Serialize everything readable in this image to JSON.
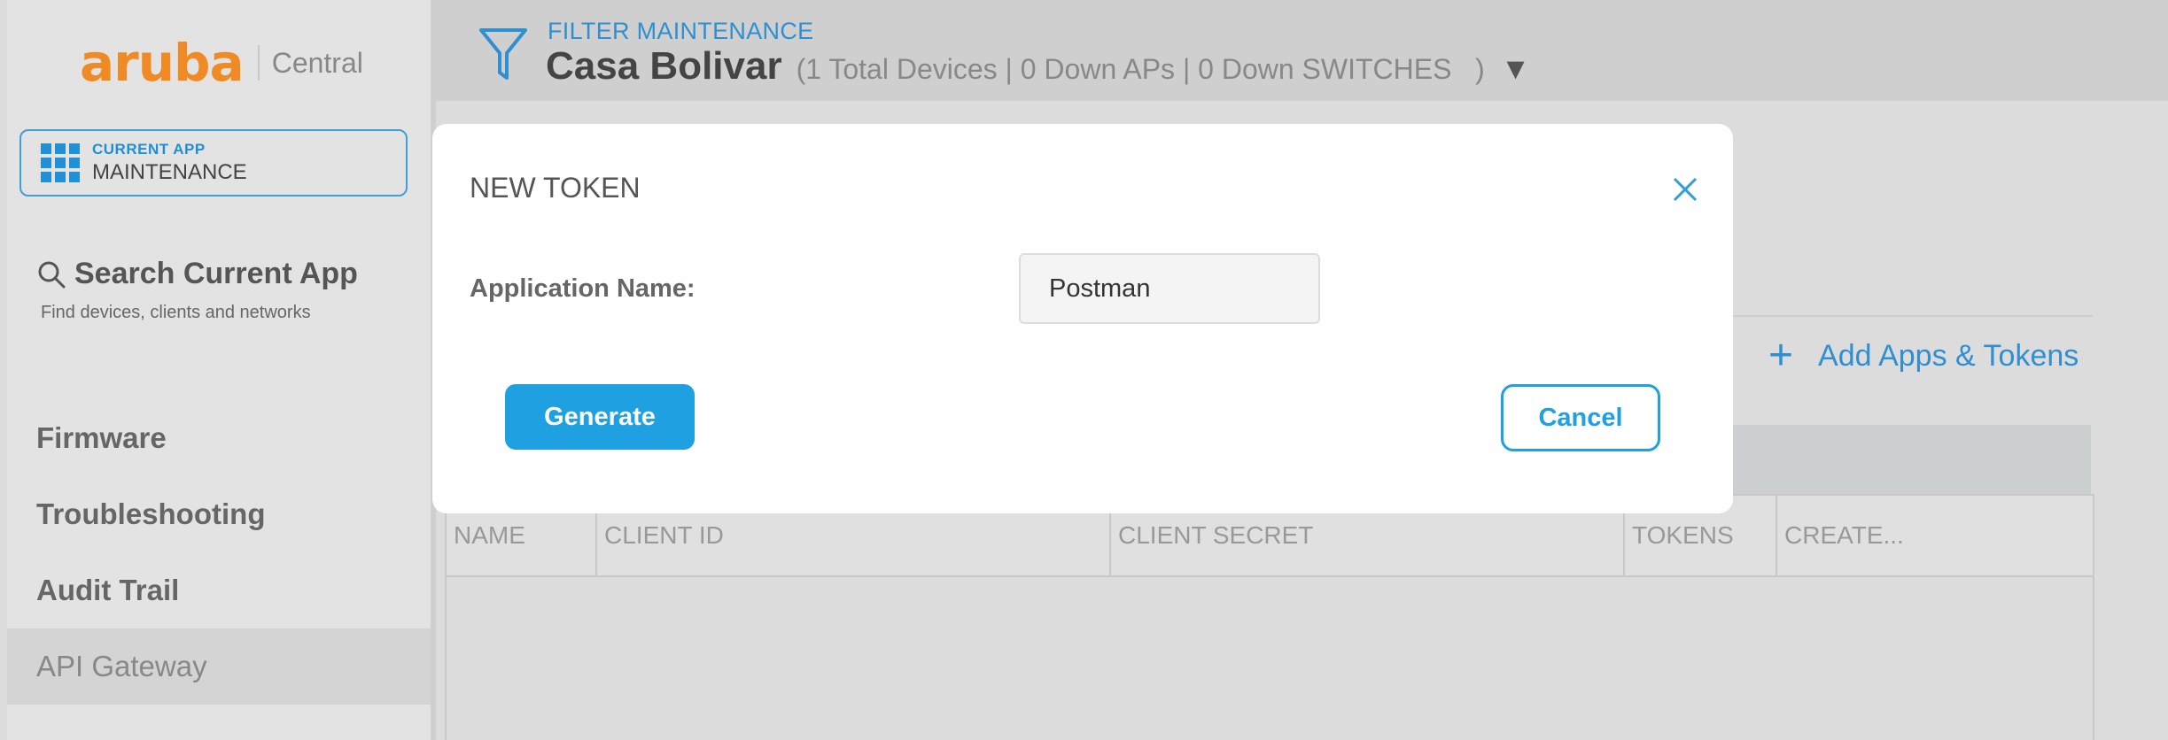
{
  "brand": {
    "logo_text": "aruba",
    "product": "Central"
  },
  "current_app": {
    "kicker": "CURRENT APP",
    "name": "MAINTENANCE"
  },
  "search": {
    "title": "Search Current App",
    "subtitle": "Find devices, clients and networks"
  },
  "nav": [
    {
      "label": "Firmware",
      "active": false
    },
    {
      "label": "Troubleshooting",
      "active": false
    },
    {
      "label": "Audit Trail",
      "active": false
    },
    {
      "label": "API Gateway",
      "active": true
    }
  ],
  "header": {
    "filter_label": "FILTER MAINTENANCE",
    "site_name": "Casa Bolivar",
    "site_stats": "(1 Total Devices | 0 Down APs | 0 Down SWITCHES   )",
    "caret": "▼"
  },
  "main": {
    "add_apps_label": "Add Apps & Tokens",
    "table_headers": [
      "NAME",
      "CLIENT ID",
      "CLIENT SECRET",
      "TOKENS",
      "CREATE..."
    ]
  },
  "modal": {
    "title": "NEW TOKEN",
    "field_label": "Application Name:",
    "field_value": "Postman",
    "generate_label": "Generate",
    "cancel_label": "Cancel"
  },
  "colors": {
    "accent": "#1ea0e1",
    "brand_orange": "#f08a24",
    "link_blue": "#2f8fd0"
  }
}
